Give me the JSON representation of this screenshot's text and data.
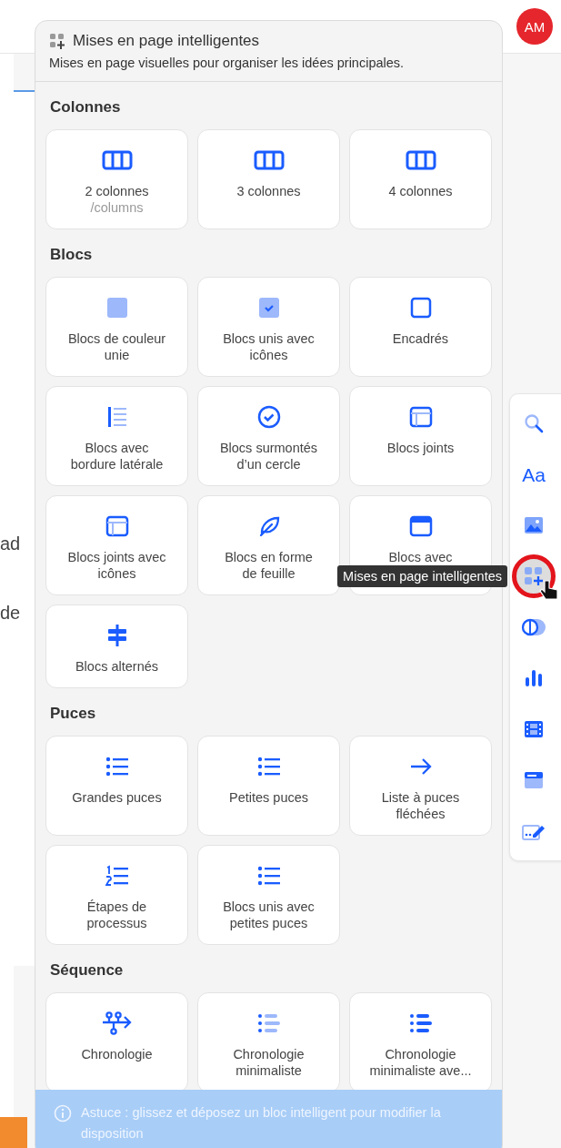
{
  "editor": {
    "avatar": "AM",
    "fragments": [
      "ad",
      "de"
    ]
  },
  "panel": {
    "title": "Mises en page intelligentes",
    "subtitle": "Mises en page visuelles pour organiser les idées principales.",
    "sections": [
      {
        "title": "Colonnes",
        "items": [
          {
            "kind": "columns",
            "label": "2 colonnes",
            "sublabel": "/columns"
          },
          {
            "kind": "columns",
            "label": "3 colonnes"
          },
          {
            "kind": "columns",
            "label": "4 colonnes"
          }
        ]
      },
      {
        "title": "Blocs",
        "items": [
          {
            "kind": "solid",
            "label": "Blocs de couleur unie"
          },
          {
            "kind": "checkbox",
            "label": "Blocs unis avec icônes"
          },
          {
            "kind": "outline",
            "label": "Encadrés"
          },
          {
            "kind": "sideborder",
            "label": "Blocs avec bordure latérale"
          },
          {
            "kind": "circle",
            "label": "Blocs surmontés d’un cercle"
          },
          {
            "kind": "joined",
            "label": "Blocs joints"
          },
          {
            "kind": "joined",
            "label": "Blocs joints avec icônes"
          },
          {
            "kind": "leaf",
            "label": "Blocs en forme de feuille"
          },
          {
            "kind": "header",
            "label": "Blocs avec"
          },
          {
            "kind": "alternating",
            "label": "Blocs alternés"
          }
        ]
      },
      {
        "title": "Puces",
        "items": [
          {
            "kind": "bullets",
            "label": "Grandes puces"
          },
          {
            "kind": "bullets",
            "label": "Petites puces"
          },
          {
            "kind": "arrow",
            "label": "Liste à puces fléchées"
          },
          {
            "kind": "numbered",
            "label": "Étapes de processus"
          },
          {
            "kind": "bullets",
            "label": "Blocs unis avec petites puces"
          }
        ]
      },
      {
        "title": "Séquence",
        "items": [
          {
            "kind": "timeline",
            "label": "Chronologie"
          },
          {
            "kind": "minimal",
            "label": "Chronologie minimaliste"
          },
          {
            "kind": "minimalbold",
            "label": "Chronologie minimaliste ave..."
          }
        ]
      }
    ],
    "tip": "Astuce : glissez et déposez un bloc intelligent pour modifier la disposition"
  },
  "tooltip": "Mises en page intelligentes",
  "toolbar": [
    {
      "kind": "search",
      "selected": false
    },
    {
      "kind": "text",
      "label": "Aa",
      "selected": false
    },
    {
      "kind": "image",
      "selected": false
    },
    {
      "kind": "layouts",
      "selected": true
    },
    {
      "kind": "toggle",
      "selected": false
    },
    {
      "kind": "chart",
      "selected": false
    },
    {
      "kind": "film",
      "selected": false
    },
    {
      "kind": "card",
      "selected": false
    },
    {
      "kind": "edit",
      "selected": false
    }
  ]
}
